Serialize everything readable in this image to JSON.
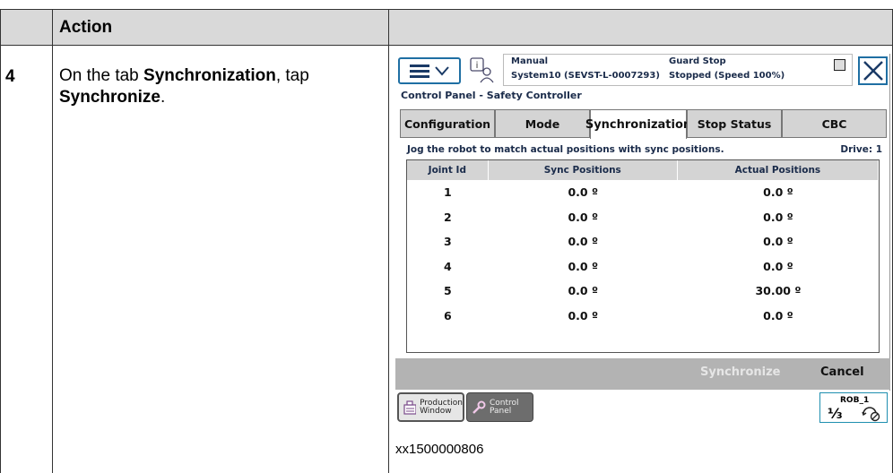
{
  "table": {
    "header": "Action",
    "step_number": "4",
    "step_text_1": "On the tab ",
    "step_text_bold_1": "Synchronization",
    "step_text_2": ", tap ",
    "step_text_bold_2": "Synchronize",
    "step_text_3": ".",
    "caption": "xx1500000806"
  },
  "pendant": {
    "status": {
      "mode": "Manual",
      "system": "System10 (SEVST-L-0007293)",
      "state": "Guard Stop",
      "speed": "Stopped (Speed 100%)"
    },
    "panel_title": "Control Panel - Safety Controller",
    "tabs": [
      {
        "label": "Configuration",
        "active": false
      },
      {
        "label": "Mode",
        "active": false
      },
      {
        "label": "Synchronization",
        "active": true
      },
      {
        "label": "Stop Status",
        "active": false
      },
      {
        "label": "CBC",
        "active": false
      }
    ],
    "instruction": "Jog the robot to match actual positions with sync positions.",
    "drive": "Drive: 1",
    "columns": [
      "Joint Id",
      "Sync Positions",
      "Actual Positions"
    ],
    "rows": [
      {
        "joint": "1",
        "sync": "0.0 º",
        "actual": "0.0 º"
      },
      {
        "joint": "2",
        "sync": "0.0 º",
        "actual": "0.0 º"
      },
      {
        "joint": "3",
        "sync": "0.0 º",
        "actual": "0.0 º"
      },
      {
        "joint": "4",
        "sync": "0.0 º",
        "actual": "0.0 º"
      },
      {
        "joint": "5",
        "sync": "0.0 º",
        "actual": "30.00 º"
      },
      {
        "joint": "6",
        "sync": "0.0 º",
        "actual": "0.0 º"
      }
    ],
    "actions": {
      "synchronize": "Synchronize",
      "cancel": "Cancel"
    },
    "taskbar": {
      "production_1": "Production",
      "production_2": "Window",
      "control_1": "Control",
      "control_2": "Panel",
      "rob": "ROB_1",
      "fraction": "⅓"
    },
    "icons": {
      "menu": "hamburger-icon",
      "status": "operator-info-icon",
      "close": "close-icon",
      "production": "production-window-icon",
      "control": "control-panel-icon",
      "rob": "robot-unit-icon"
    }
  }
}
